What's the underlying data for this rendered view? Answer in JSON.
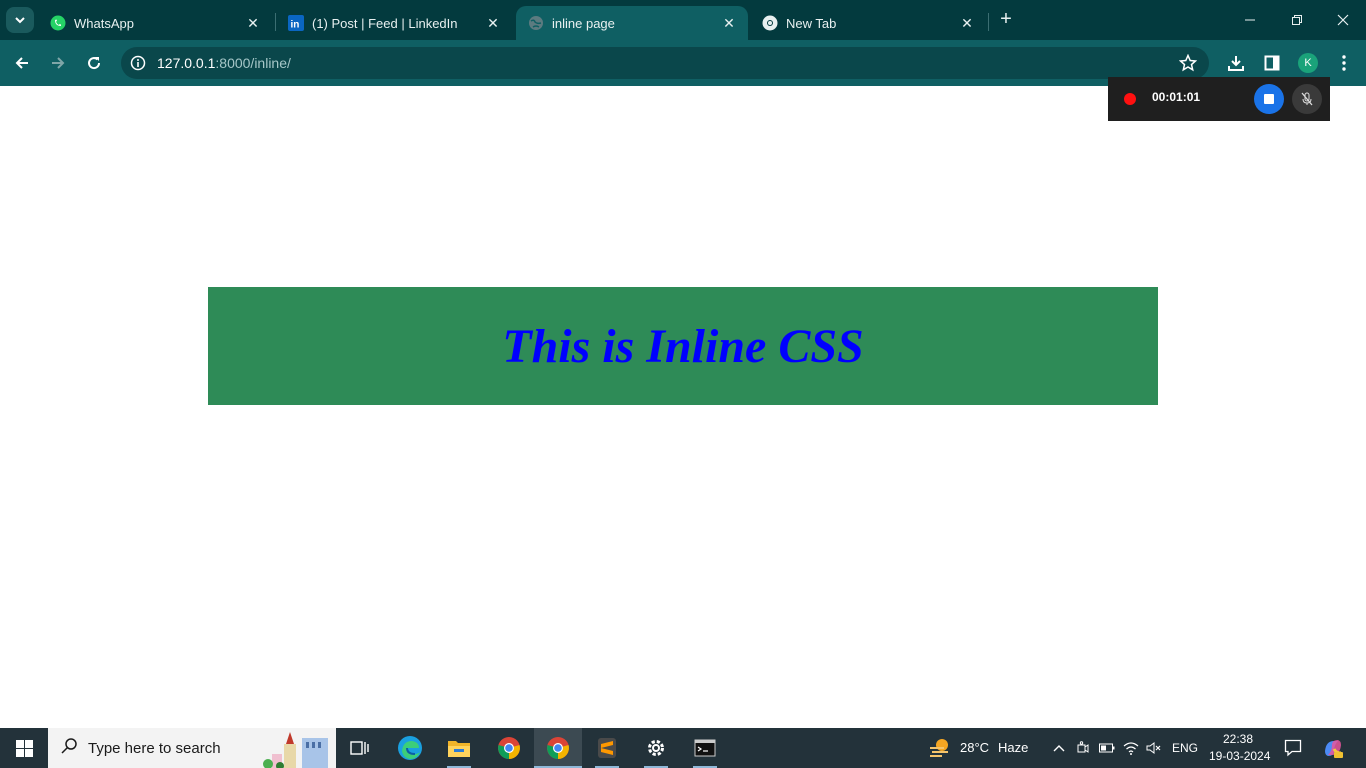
{
  "browser": {
    "tabs": [
      {
        "title": "WhatsApp",
        "favicon": "whatsapp-icon",
        "active": false
      },
      {
        "title": "(1) Post | Feed | LinkedIn",
        "favicon": "linkedin-icon",
        "active": false
      },
      {
        "title": "inline page",
        "favicon": "globe-icon",
        "active": true
      },
      {
        "title": "New Tab",
        "favicon": "chrome-icon",
        "active": false
      }
    ],
    "new_tab_label": "+",
    "url_host": "127.0.0.1",
    "url_rest": ":8000/inline/",
    "profile_initial": "K",
    "colors": {
      "frame": "#033a3e",
      "toolbar": "#0f5f63",
      "omnibox": "#0a474b"
    }
  },
  "recorder": {
    "time": "00:01:01"
  },
  "page": {
    "heading": "This is Inline CSS",
    "box_color": "#2e8b57",
    "text_color": "#0000ff"
  },
  "taskbar": {
    "search_placeholder": "Type here to search",
    "apps": [
      "task-view-icon",
      "edge-icon",
      "file-explorer-icon",
      "chrome-icon",
      "chrome-icon",
      "sublime-text-icon",
      "settings-icon",
      "terminal-icon"
    ],
    "weather_temp": "28°C",
    "weather_desc": "Haze",
    "language": "ENG",
    "time": "22:38",
    "date": "19-03-2024"
  }
}
